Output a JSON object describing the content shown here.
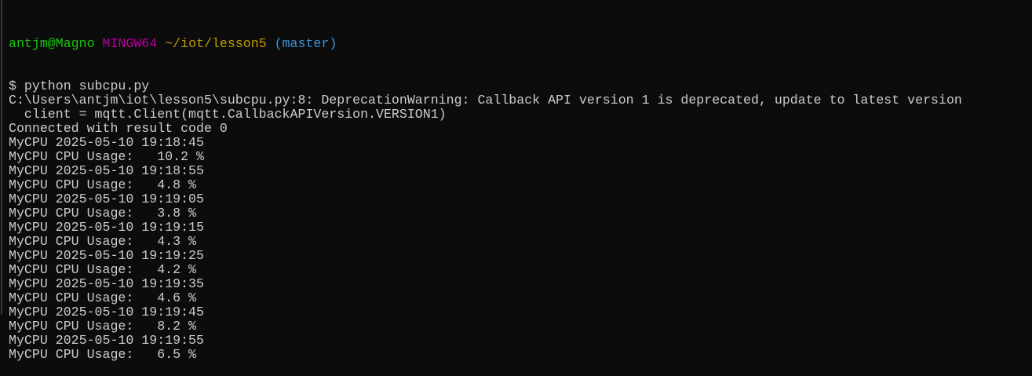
{
  "prompt": {
    "user_host": "antjm@Magno",
    "system": "MINGW64",
    "path": "~/iot/lesson5",
    "branch": "(master)"
  },
  "colors": {
    "user_host": "#16c60c",
    "system": "#b4009e",
    "path": "#c19c00",
    "branch": "#3a96dd",
    "text": "#cccccc",
    "background": "#0c0c0c"
  },
  "lines": [
    "$ python subcpu.py",
    "C:\\Users\\antjm\\iot\\lesson5\\subcpu.py:8: DeprecationWarning: Callback API version 1 is deprecated, update to latest version",
    "  client = mqtt.Client(mqtt.CallbackAPIVersion.VERSION1)",
    "Connected with result code 0",
    "MyCPU 2025-05-10 19:18:45",
    "MyCPU CPU Usage:   10.2 %",
    "MyCPU 2025-05-10 19:18:55",
    "MyCPU CPU Usage:   4.8 %",
    "MyCPU 2025-05-10 19:19:05",
    "MyCPU CPU Usage:   3.8 %",
    "MyCPU 2025-05-10 19:19:15",
    "MyCPU CPU Usage:   4.3 %",
    "MyCPU 2025-05-10 19:19:25",
    "MyCPU CPU Usage:   4.2 %",
    "MyCPU 2025-05-10 19:19:35",
    "MyCPU CPU Usage:   4.6 %",
    "MyCPU 2025-05-10 19:19:45",
    "MyCPU CPU Usage:   8.2 %",
    "MyCPU 2025-05-10 19:19:55",
    "MyCPU CPU Usage:   6.5 %"
  ]
}
